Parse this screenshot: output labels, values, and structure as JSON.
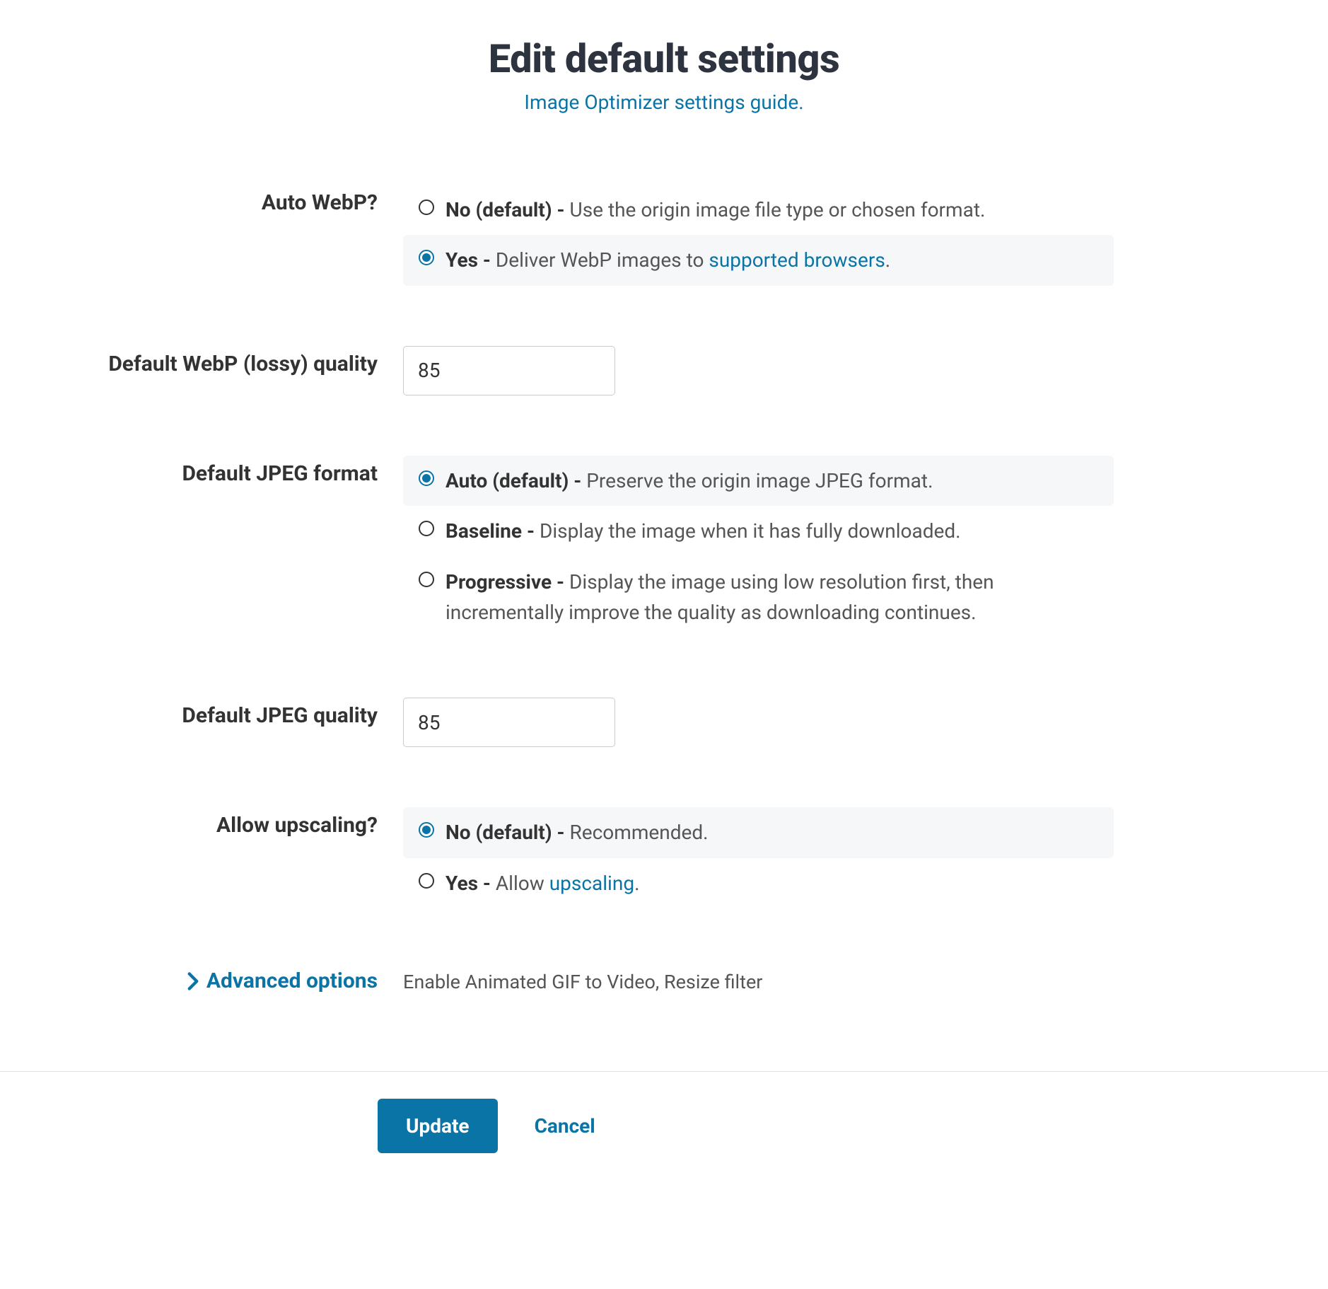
{
  "header": {
    "title": "Edit default settings",
    "guide_link": "Image Optimizer settings guide."
  },
  "fields": {
    "auto_webp": {
      "label": "Auto WebP?",
      "options": {
        "no": {
          "strong": "No (default) - ",
          "desc": "Use the origin image file type or chosen format."
        },
        "yes": {
          "strong": "Yes - ",
          "desc_before": "Deliver WebP images to ",
          "link": "supported browsers",
          "desc_after": "."
        }
      },
      "selected": "yes"
    },
    "webp_quality": {
      "label": "Default WebP (lossy) quality",
      "value": "85"
    },
    "jpeg_format": {
      "label": "Default JPEG format",
      "options": {
        "auto": {
          "strong": "Auto (default) - ",
          "desc": "Preserve the origin image JPEG format."
        },
        "baseline": {
          "strong": "Baseline - ",
          "desc": "Display the image when it has fully downloaded."
        },
        "progressive": {
          "strong": "Progressive - ",
          "desc": "Display the image using low resolution first, then incrementally improve the quality as downloading continues."
        }
      },
      "selected": "auto"
    },
    "jpeg_quality": {
      "label": "Default JPEG quality",
      "value": "85"
    },
    "upscaling": {
      "label": "Allow upscaling?",
      "options": {
        "no": {
          "strong": "No (default) - ",
          "desc": "Recommended."
        },
        "yes": {
          "strong": "Yes - ",
          "desc_before": "Allow ",
          "link": "upscaling",
          "desc_after": "."
        }
      },
      "selected": "no"
    },
    "advanced": {
      "toggle_label": "Advanced options",
      "description": "Enable Animated GIF to Video, Resize filter"
    }
  },
  "footer": {
    "update": "Update",
    "cancel": "Cancel"
  }
}
